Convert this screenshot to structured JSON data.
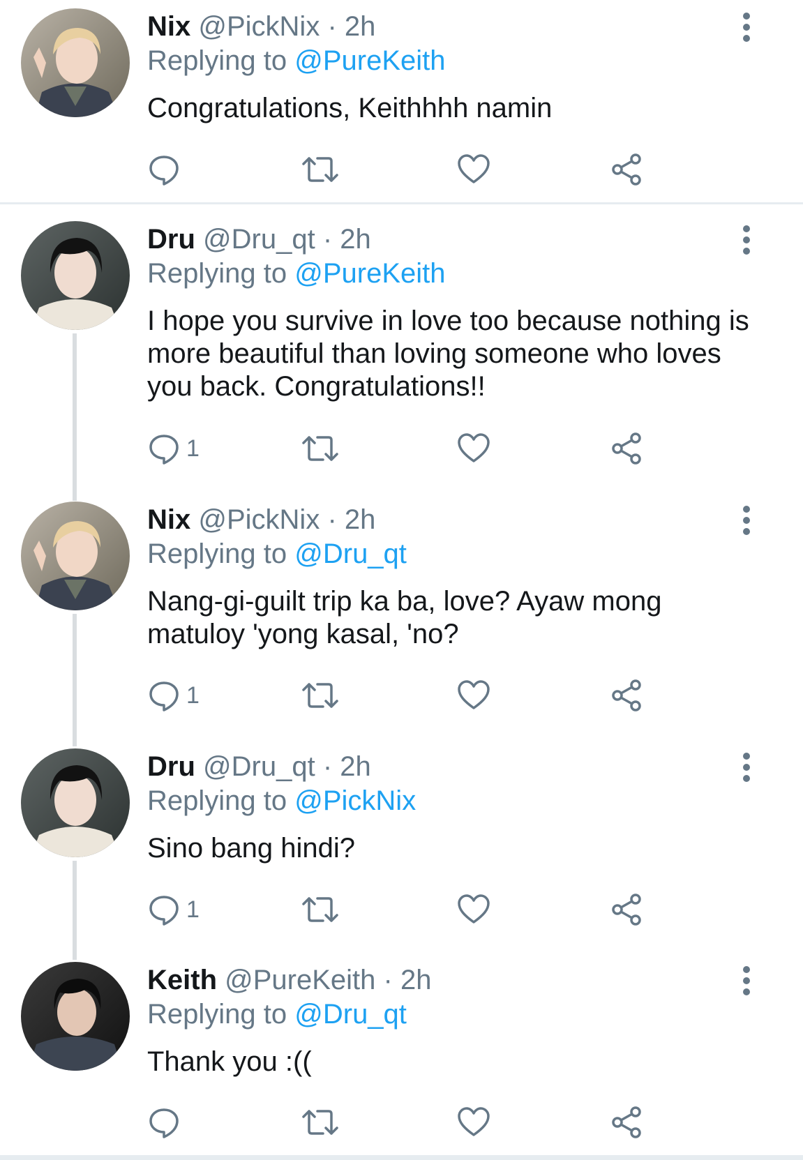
{
  "colors": {
    "text": "#14171a",
    "muted": "#657786",
    "link": "#1da1f2",
    "icon": "#657786",
    "thread_line": "#d9dde0"
  },
  "tweets": [
    {
      "name": "Nix",
      "handle": "@PickNix",
      "separator": "·",
      "time": "2h",
      "replying_label": "Replying to",
      "replying_to": "@PureKeith",
      "text": "Congratulations, Keithhhh namin",
      "reply_count": "",
      "avatar": "nix-avatar"
    },
    {
      "name": "Dru",
      "handle": "@Dru_qt",
      "separator": "·",
      "time": "2h",
      "replying_label": "Replying to",
      "replying_to": "@PureKeith",
      "text": "I hope you survive in love too because nothing is more beautiful than loving someone who loves you back. Congratulations!!",
      "reply_count": "1",
      "avatar": "dru-avatar"
    },
    {
      "name": "Nix",
      "handle": "@PickNix",
      "separator": "·",
      "time": "2h",
      "replying_label": "Replying to",
      "replying_to": "@Dru_qt",
      "text": "Nang-gi-guilt trip ka ba, love? Ayaw mong matuloy 'yong kasal, 'no?",
      "reply_count": "1",
      "avatar": "nix-avatar"
    },
    {
      "name": "Dru",
      "handle": "@Dru_qt",
      "separator": "·",
      "time": "2h",
      "replying_label": "Replying to",
      "replying_to": "@PickNix",
      "text": "Sino bang hindi?",
      "reply_count": "1",
      "avatar": "dru-avatar"
    },
    {
      "name": "Keith",
      "handle": "@PureKeith",
      "separator": "·",
      "time": "2h",
      "replying_label": "Replying to",
      "replying_to": "@Dru_qt",
      "text": "Thank you :((",
      "reply_count": "",
      "avatar": "keith-avatar"
    }
  ]
}
